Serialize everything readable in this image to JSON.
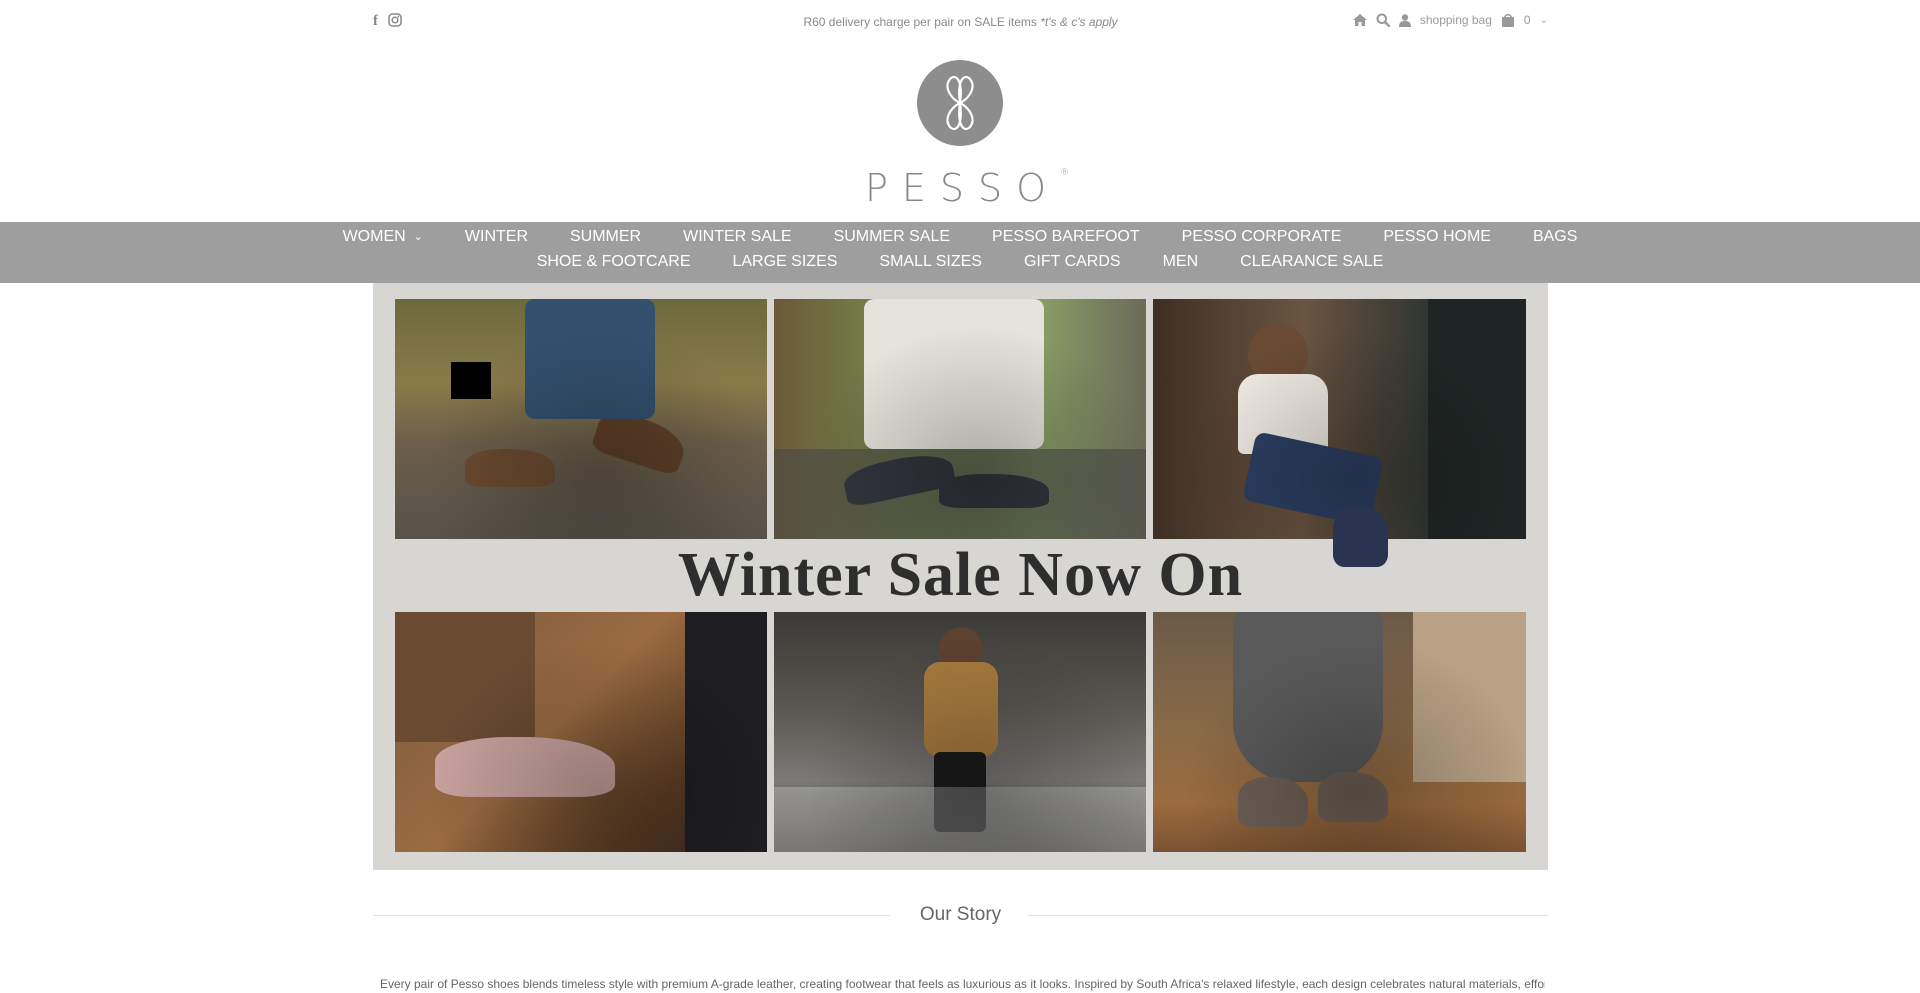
{
  "topbar": {
    "promo_text": "R60 delivery charge per pair on SALE items ",
    "promo_terms": "*t's & c's apply",
    "social": [
      "facebook-icon",
      "instagram-icon"
    ],
    "bag_label": "shopping bag",
    "bag_count": "0"
  },
  "brand": {
    "name": "PESSO",
    "mark": "®"
  },
  "nav": {
    "row1": [
      {
        "label": "WOMEN",
        "has_dropdown": true
      },
      {
        "label": "WINTER"
      },
      {
        "label": "SUMMER"
      },
      {
        "label": "WINTER SALE"
      },
      {
        "label": "SUMMER SALE"
      },
      {
        "label": "PESSO BAREFOOT"
      },
      {
        "label": "PESSO CORPORATE"
      },
      {
        "label": "PESSO HOME"
      },
      {
        "label": "BAGS"
      }
    ],
    "row2": [
      {
        "label": "SHOE & FOOTCARE"
      },
      {
        "label": "LARGE SIZES"
      },
      {
        "label": "SMALL SIZES"
      },
      {
        "label": "GIFT CARDS"
      },
      {
        "label": "MEN"
      },
      {
        "label": "CLEARANCE SALE"
      }
    ]
  },
  "hero": {
    "title": "Winter Sale Now On"
  },
  "story": {
    "title": "Our Story",
    "text": "Every pair of Pesso shoes blends timeless style with premium A-grade leather, creating footwear that feels as luxurious as it looks. Inspired by South Africa's relaxed lifestyle, each design celebrates natural materials, effortless"
  }
}
